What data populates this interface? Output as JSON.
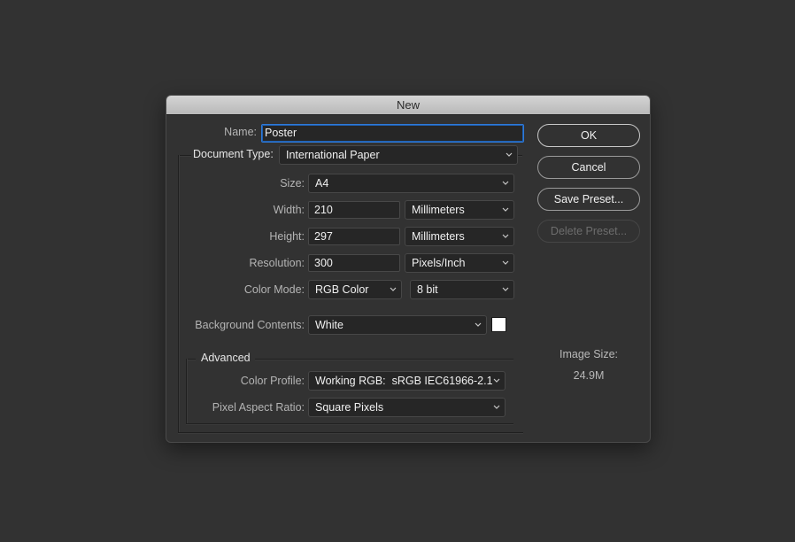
{
  "dialog": {
    "title": "New",
    "name_label": "Name:",
    "name_value": "Poster",
    "document_type_label": "Document Type:",
    "document_type_value": "International Paper",
    "size_label": "Size:",
    "size_value": "A4",
    "width_label": "Width:",
    "width_value": "210",
    "width_unit": "Millimeters",
    "height_label": "Height:",
    "height_value": "297",
    "height_unit": "Millimeters",
    "resolution_label": "Resolution:",
    "resolution_value": "300",
    "resolution_unit": "Pixels/Inch",
    "color_mode_label": "Color Mode:",
    "color_mode_value": "RGB Color",
    "bit_depth_value": "8 bit",
    "background_label": "Background Contents:",
    "background_value": "White",
    "background_swatch_color": "#ffffff",
    "advanced": {
      "legend": "Advanced",
      "color_profile_label": "Color Profile:",
      "color_profile_value": "Working RGB:  sRGB IEC61966-2.1",
      "pixel_aspect_label": "Pixel Aspect Ratio:",
      "pixel_aspect_value": "Square Pixels"
    },
    "buttons": {
      "ok": "OK",
      "cancel": "Cancel",
      "save_preset": "Save Preset...",
      "delete_preset": "Delete Preset..."
    },
    "image_size_label": "Image Size:",
    "image_size_value": "24.9M"
  }
}
